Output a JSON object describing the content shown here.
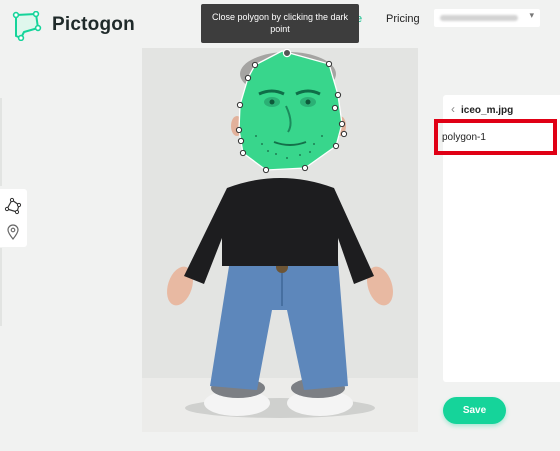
{
  "header": {
    "brand": "Pictogon",
    "nav_partial": "e",
    "nav_pricing": "Pricing",
    "account_chevron": "▾"
  },
  "tooltip": {
    "text": "Close polygon by clicking the dark point"
  },
  "toolbar": {
    "tools": [
      "polygon-tool-icon",
      "location-pin-icon"
    ]
  },
  "panel": {
    "back_icon": "‹",
    "filename": "iceo_m.jpg",
    "polygons": [
      {
        "label": "polygon-1",
        "highlighted": true
      }
    ]
  },
  "actions": {
    "save_label": "Save"
  },
  "colors": {
    "accent": "#15d49a",
    "polygon_fill": "#3ed98f",
    "highlight": "#e00015",
    "tooltip_bg": "#3d3d3d"
  }
}
